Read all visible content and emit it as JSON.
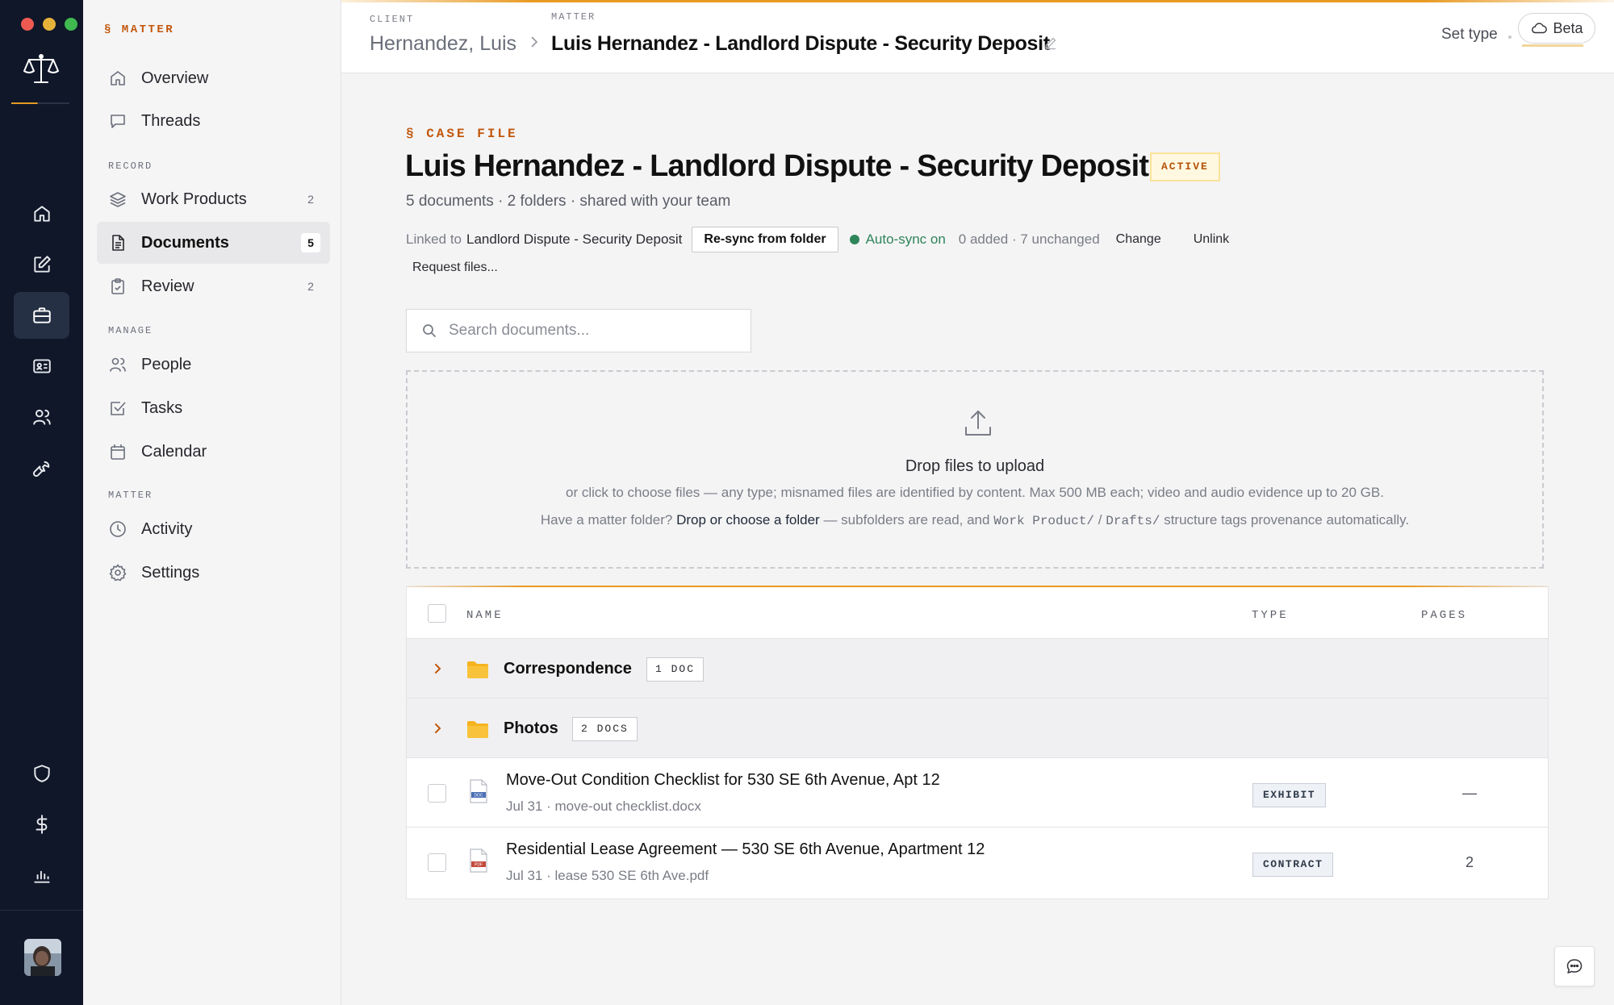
{
  "rail": {
    "icons": [
      "scales-logo-icon",
      "home-icon",
      "edit-icon",
      "briefcase-icon",
      "id-card-icon",
      "users-icon",
      "wrench-icon",
      "shield-icon",
      "dollar-icon",
      "bar-chart-icon"
    ],
    "active": "briefcase-icon",
    "accent_color": "#e89a23"
  },
  "sidebar": {
    "eyebrow": "§ MATTER",
    "items_top": [
      {
        "label": "Overview",
        "icon": "home-icon"
      },
      {
        "label": "Threads",
        "icon": "chat-bubble-icon"
      }
    ],
    "record_heading": "RECORD",
    "record_items": [
      {
        "label": "Work Products",
        "icon": "layers-icon",
        "count": "2"
      },
      {
        "label": "Documents",
        "icon": "document-icon",
        "count": "5",
        "active": true
      },
      {
        "label": "Review",
        "icon": "clipboard-check-icon",
        "count": "2"
      }
    ],
    "manage_heading": "MANAGE",
    "manage_items": [
      {
        "label": "People",
        "icon": "users-icon"
      },
      {
        "label": "Tasks",
        "icon": "checkbox-icon"
      },
      {
        "label": "Calendar",
        "icon": "calendar-icon"
      }
    ],
    "matter_heading": "MATTER",
    "matter_items": [
      {
        "label": "Activity",
        "icon": "clock-icon"
      },
      {
        "label": "Settings",
        "icon": "gear-icon"
      }
    ]
  },
  "header": {
    "client_label": "CLIENT",
    "client_name": "Hernandez, Luis",
    "matter_label": "MATTER",
    "matter_name": "Luis Hernandez - Landlord Dispute - Security Deposit",
    "set_type": "Set type",
    "beta": "Beta"
  },
  "main": {
    "eyebrow": "§ CASE FILE",
    "title": "Luis Hernandez - Landlord Dispute - Security Deposit",
    "status": "ACTIVE",
    "subline": "5 documents · 2 folders · shared with your team",
    "linked_prefix": "Linked to",
    "linked_target": "Landlord Dispute - Security Deposit",
    "resync_label": "Re-sync from folder",
    "autosync_label": "Auto-sync on",
    "sync_stats": "0 added · 7 unchanged",
    "change_label": "Change",
    "unlink_label": "Unlink",
    "request_label": "Request files...",
    "search_placeholder": "Search documents...",
    "status_color": "#2f855a"
  },
  "dropzone": {
    "title": "Drop files to upload",
    "subtitle": "or click to choose files — any type; misnamed files are identified by content. Max 500 MB each; video and audio evidence up to 20 GB.",
    "folder_prefix": "Have a matter folder?",
    "folder_link": "Drop or choose a folder",
    "folder_mid": "— subfolders are read, and",
    "folder_path1": "Work Product/",
    "folder_slash": "/",
    "folder_path2": "Drafts/",
    "folder_suffix": "structure tags provenance automatically."
  },
  "table": {
    "columns": {
      "name": "NAME",
      "type": "TYPE",
      "pages": "PAGES"
    },
    "folders": [
      {
        "name": "Correspondence",
        "count": "1 DOC"
      },
      {
        "name": "Photos",
        "count": "2 DOCS"
      }
    ],
    "files": [
      {
        "name": "Move-Out Condition Checklist for 530 SE 6th Avenue, Apt 12",
        "meta": "Jul 31 · move-out checklist.docx",
        "type": "EXHIBIT",
        "pages": "—",
        "icon": "docx-file-icon"
      },
      {
        "name": "Residential Lease Agreement — 530 SE 6th Avenue, Apartment 12",
        "meta": "Jul 31 · lease 530 SE 6th Ave.pdf",
        "type": "CONTRACT",
        "pages": "2",
        "icon": "pdf-file-icon"
      }
    ]
  }
}
